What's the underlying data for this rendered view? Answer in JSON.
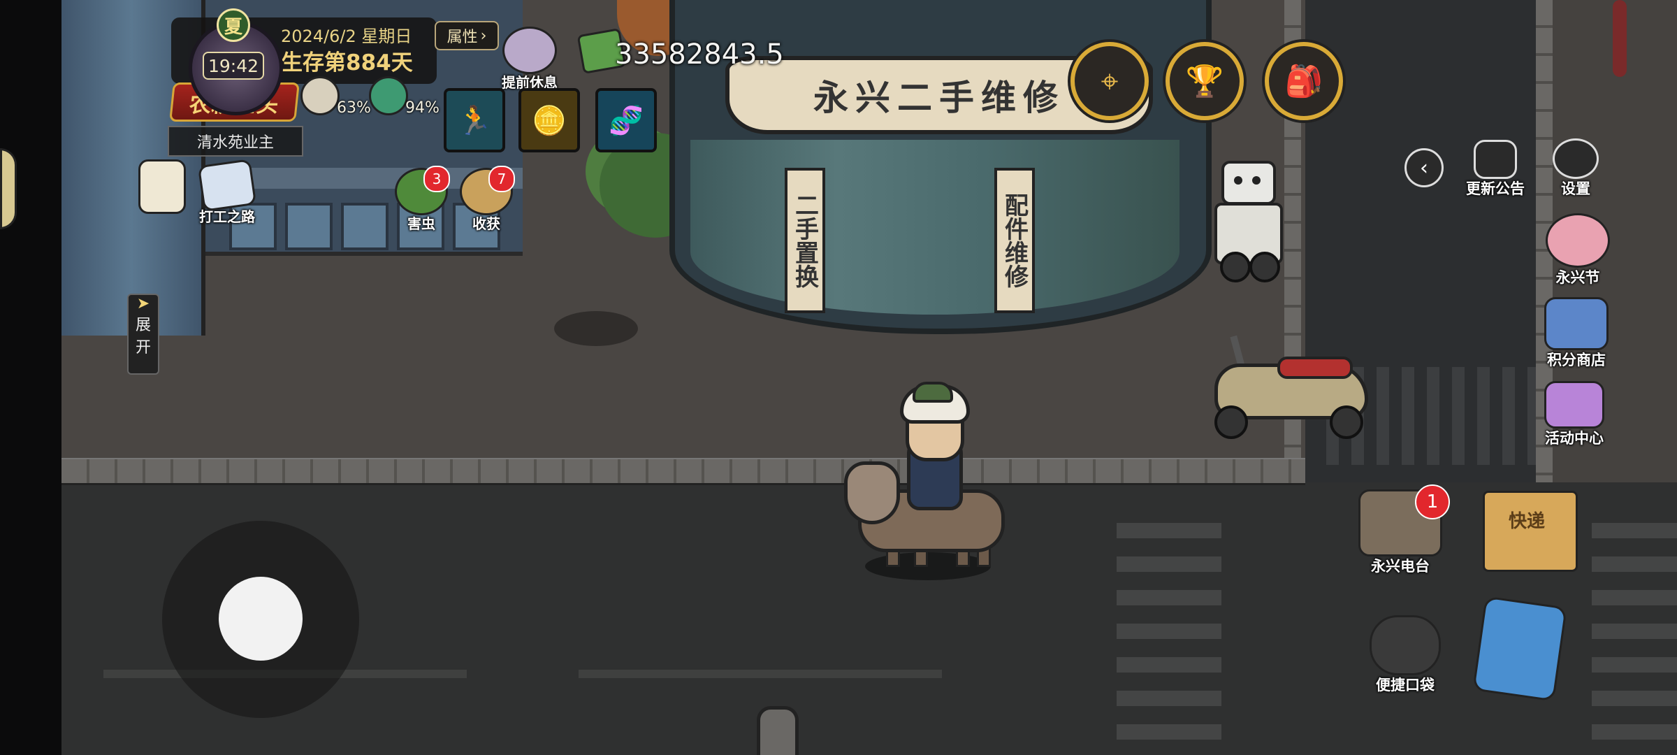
{
  "hud": {
    "season": "夏",
    "clock_time": "19:42",
    "date": "2024/6/2 星期日",
    "survival_days": "生存第884天",
    "attributes_button": "属性",
    "title_banner": "农耕巨头",
    "owner_title": "清水苑业主",
    "stats": [
      {
        "name": "hunger",
        "value": "63%",
        "icon": "food-icon"
      },
      {
        "name": "health",
        "value": "94%",
        "icon": "medicine-icon"
      }
    ],
    "rest_early": "提前休息",
    "money": "33582843.5"
  },
  "quick_actions": {
    "tasks": {
      "label": "",
      "icon": "clipboard-icon"
    },
    "work_road": {
      "label": "打工之路",
      "icon": "notebook-icon"
    },
    "pests": {
      "label": "害虫",
      "badge": "3",
      "icon": "pest-icon"
    },
    "harvest": {
      "label": "收获",
      "badge": "7",
      "icon": "harvest-hand-icon"
    }
  },
  "abilities": [
    {
      "name": "run",
      "icon": "run-icon",
      "color": "#3ad0d8"
    },
    {
      "name": "coins",
      "icon": "coin-stack-icon",
      "color": "#e7b93b"
    },
    {
      "name": "dna",
      "icon": "dna-icon",
      "color": "#33c1e0"
    }
  ],
  "top_right_buttons": [
    {
      "name": "map",
      "icon": "map-pin-icon"
    },
    {
      "name": "trophy",
      "icon": "trophy-icon"
    },
    {
      "name": "backpack",
      "icon": "backpack-icon"
    }
  ],
  "left_expand": {
    "arrow": "➤",
    "line1": "展",
    "line2": "开"
  },
  "right_menu": {
    "collapse_arrow": "‹",
    "update_notice": "更新公告",
    "settings": "设置",
    "festival": "永兴节",
    "points_shop": "积分商店",
    "event_center": "活动中心",
    "radio": "永兴电台",
    "radio_badge": "1",
    "pocket": "便捷口袋",
    "delivery": "快递"
  },
  "scene": {
    "shop_sign": "永兴二手维修",
    "shop_left_vertical": "二手置换",
    "shop_right_vertical": "配件维修"
  },
  "colors": {
    "gold": "#d9aa37",
    "badge_red": "#e2272d",
    "banner_red": "#a5231d"
  }
}
